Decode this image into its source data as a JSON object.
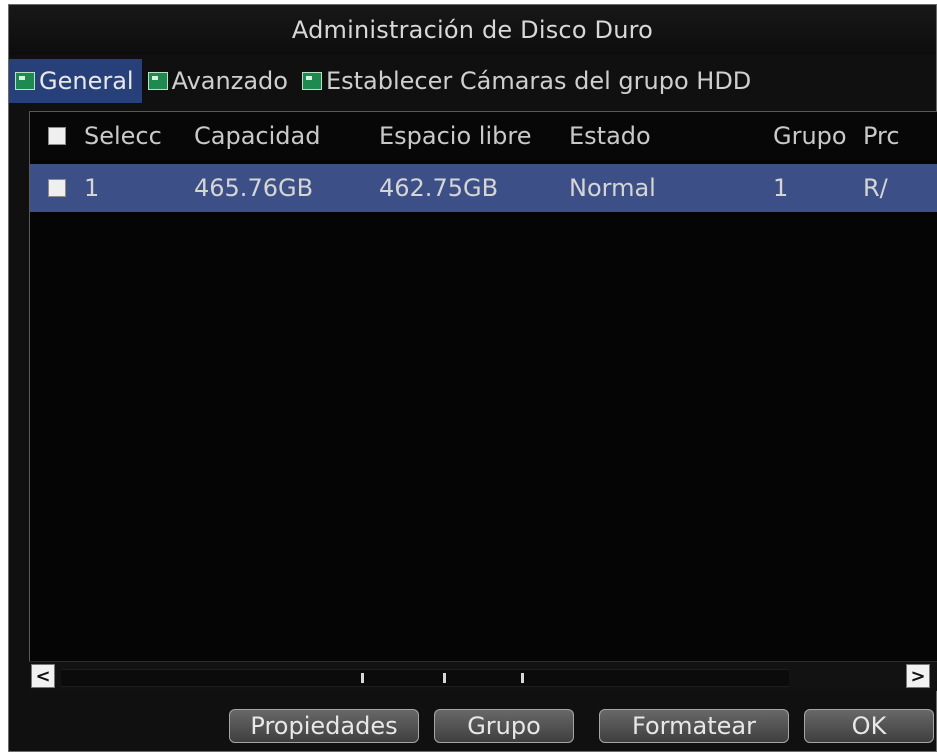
{
  "window": {
    "title": "Administración de Disco Duro"
  },
  "tabs": [
    {
      "label": "General",
      "icon": "folder-icon",
      "active": true
    },
    {
      "label": "Avanzado",
      "icon": "folder-icon",
      "active": false
    },
    {
      "label": "Establecer Cámaras del grupo HDD",
      "icon": "folder-icon",
      "active": false
    }
  ],
  "table": {
    "columns": [
      "Selecc",
      "Capacidad",
      "Espacio libre",
      "Estado",
      "Grupo",
      "Prc"
    ],
    "rows": [
      {
        "select": "1",
        "capacity": "465.76GB",
        "free_space": "462.75GB",
        "status": "Normal",
        "group": "1",
        "property": "R/"
      }
    ]
  },
  "scrollbar": {
    "left_arrow": "<",
    "right_arrow": ">"
  },
  "footer": {
    "properties": "Propiedades",
    "group": "Grupo",
    "format": "Formatear",
    "ok": "OK"
  },
  "colors": {
    "background": "#101010",
    "selected_tab": "#27407a",
    "selected_row": "#3d4f87",
    "text": "#d5d5d5"
  }
}
